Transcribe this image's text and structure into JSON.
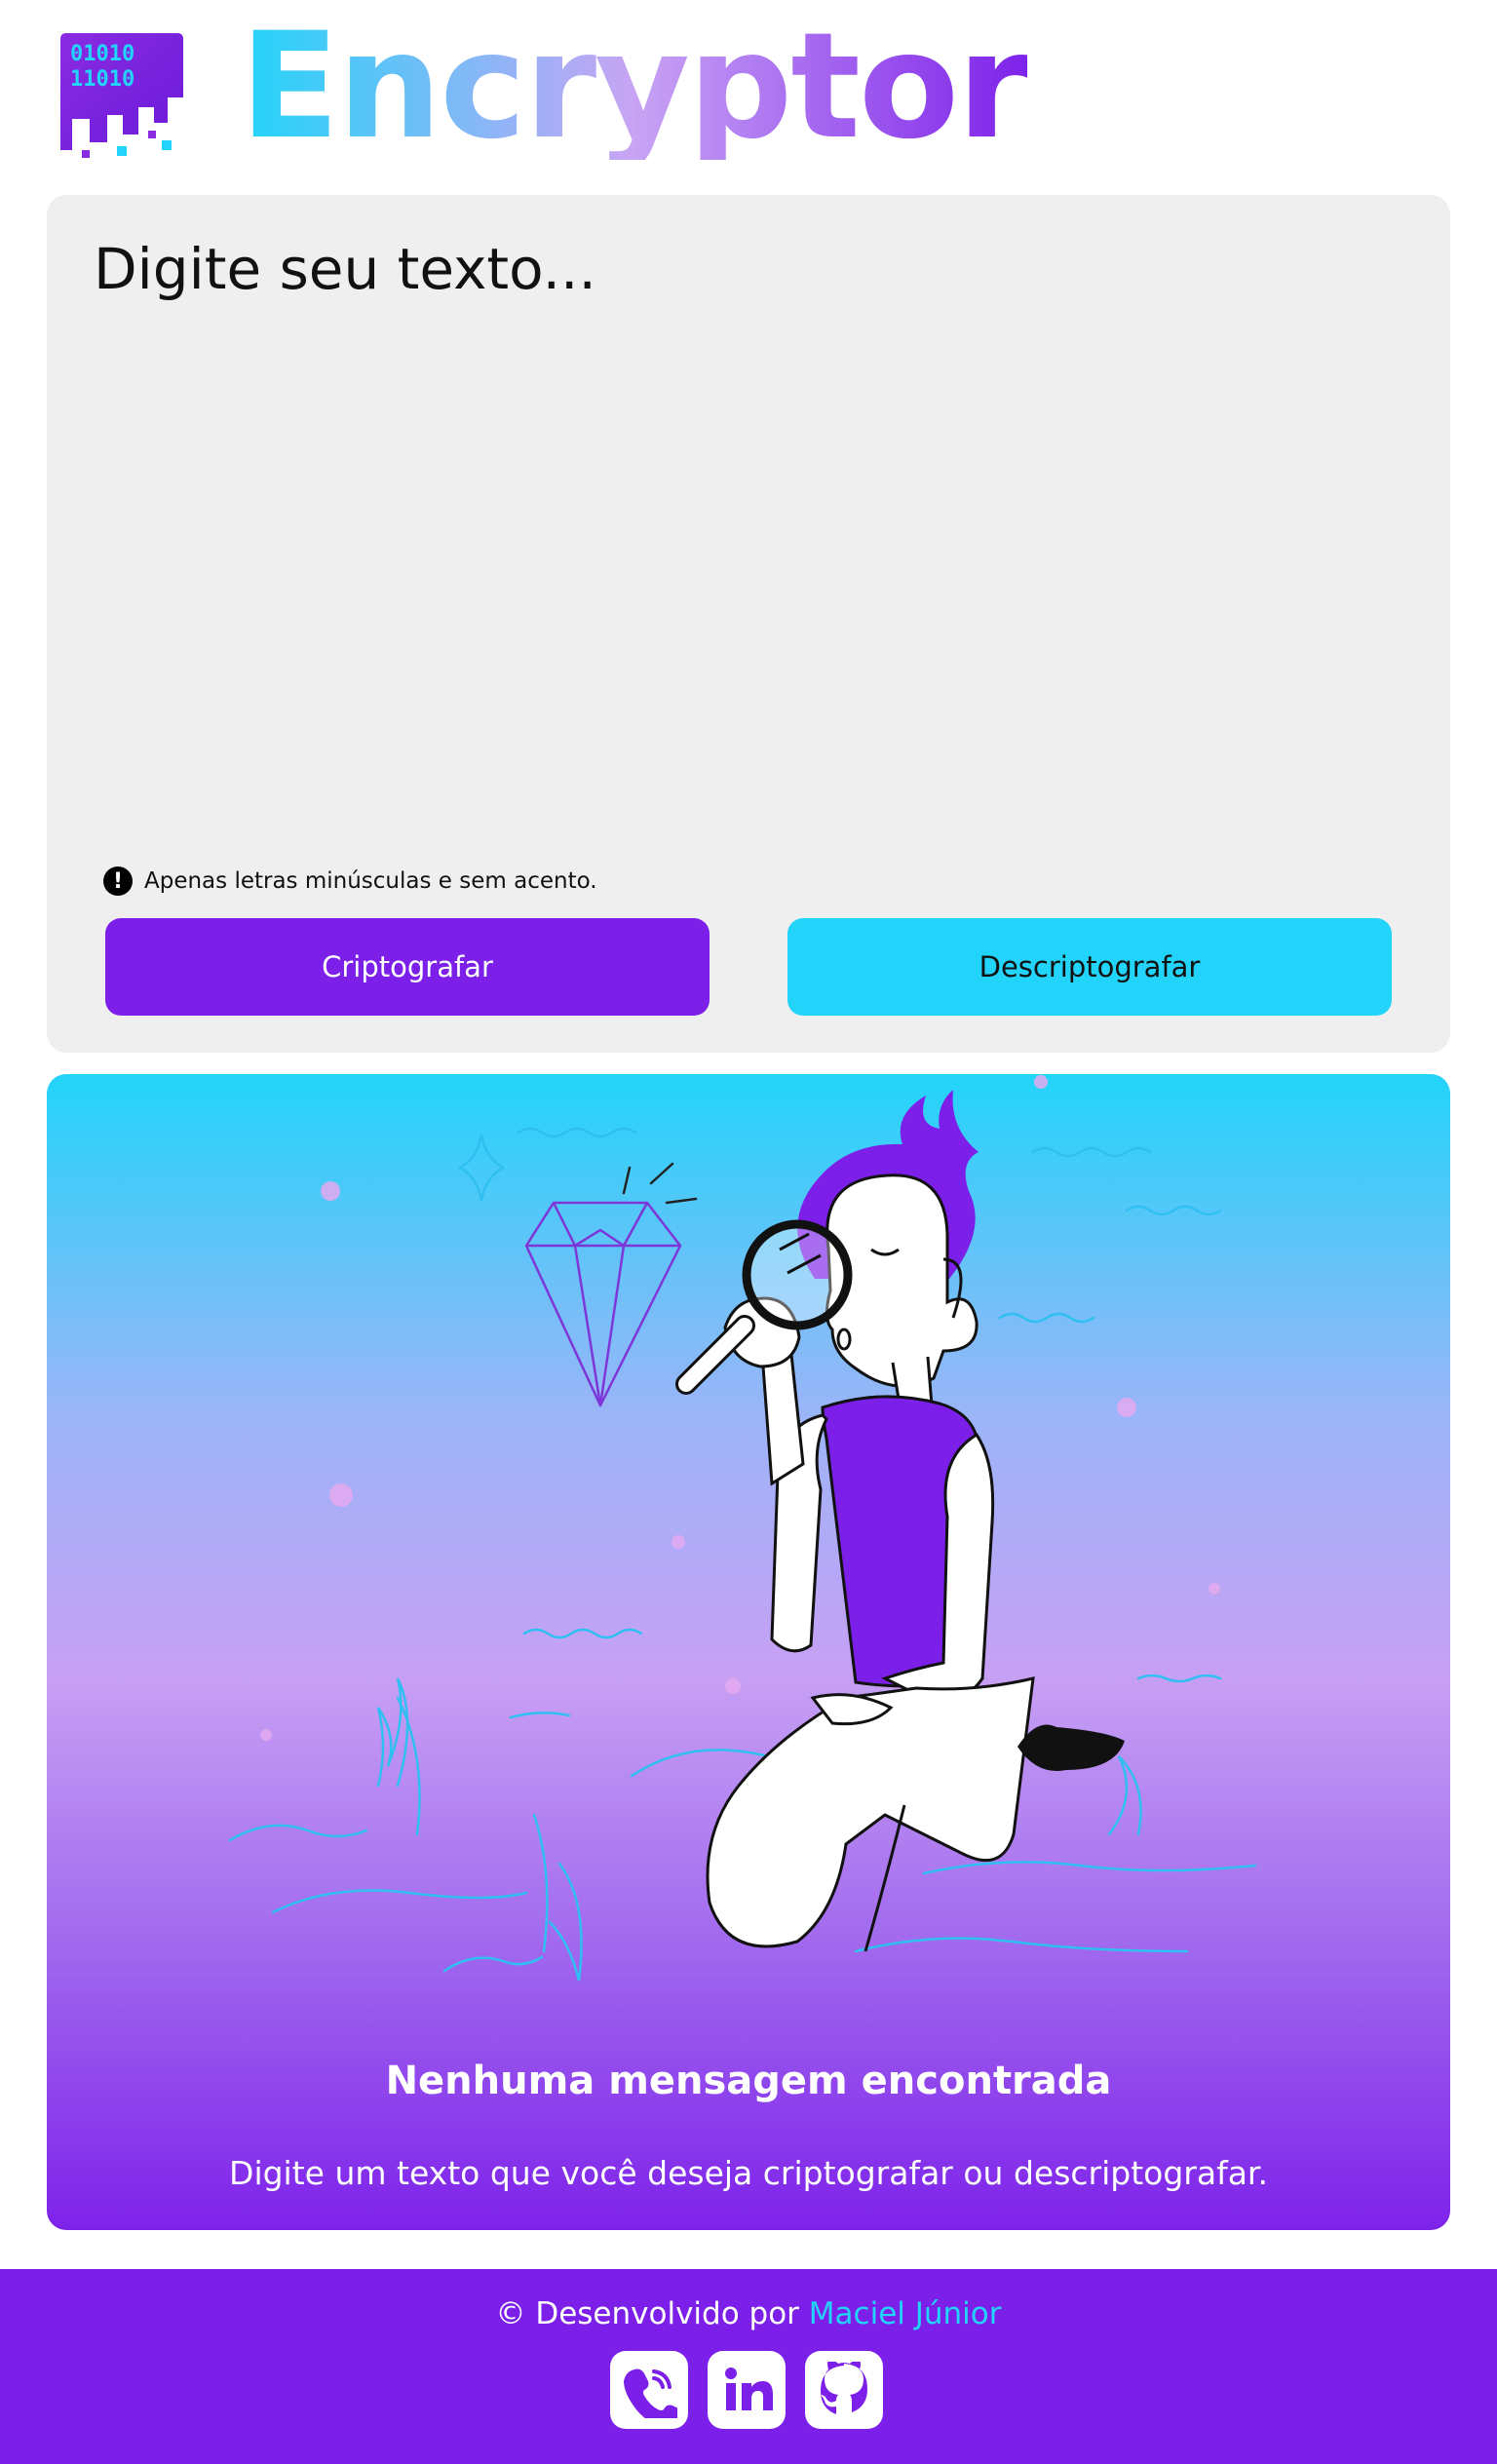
{
  "header": {
    "logo_text_row1": "01010",
    "logo_text_row2": "11010",
    "brand": "Encryptor"
  },
  "input": {
    "placeholder": "Digite seu texto...",
    "hint_icon": "!",
    "hint": "Apenas letras minúsculas e sem acento.",
    "encrypt_label": "Criptografar",
    "decrypt_label": "Descriptografar"
  },
  "output": {
    "title": "Nenhuma mensagem encontrada",
    "description": "Digite um texto que você deseja criptografar ou descriptografar."
  },
  "footer": {
    "credit_prefix": "© Desenvolvido por",
    "author": "Maciel Júnior",
    "socials": [
      "phone-icon",
      "linkedin-icon",
      "github-icon"
    ]
  },
  "colors": {
    "purple": "#7b1fe9",
    "cyan": "#22d4f9",
    "panel_bg": "#efefef"
  }
}
